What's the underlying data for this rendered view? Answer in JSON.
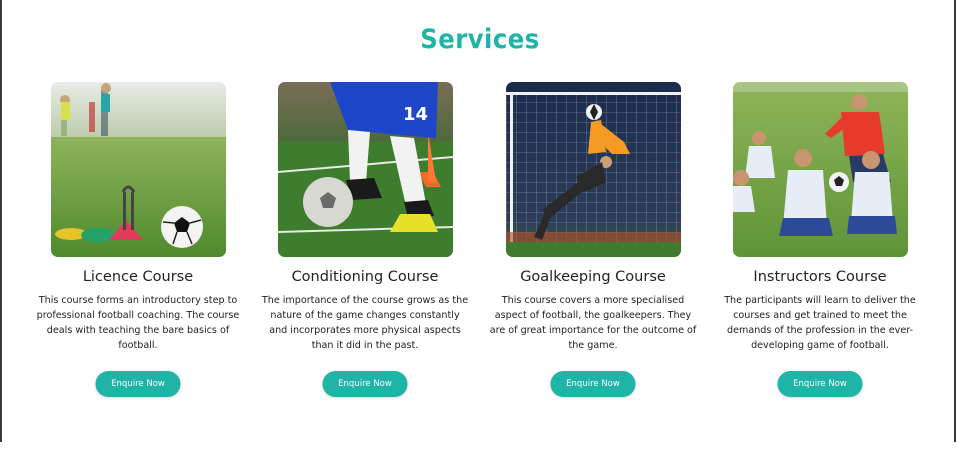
{
  "section": {
    "title": "Services"
  },
  "colors": {
    "accent": "#1fb5a6",
    "text": "#222222"
  },
  "cards": [
    {
      "image_icon": "football-cones-photo",
      "title": "Licence Course",
      "description": "This course forms an introductory step to professional football coaching. The course deals with teaching the bare basics of football.",
      "button": "Enquire Now"
    },
    {
      "image_icon": "player-dribbling-photo",
      "title": "Conditioning Course",
      "description": "The importance of the course grows as the nature of the game changes constantly and incorporates more physical aspects than it did in the past.",
      "button": "Enquire Now"
    },
    {
      "image_icon": "goalkeeper-dive-photo",
      "title": "Goalkeeping Course",
      "description": "This course covers a more specialised aspect of football, the goalkeepers. They are of great importance for the outcome of the game.",
      "button": "Enquire Now"
    },
    {
      "image_icon": "coach-instructing-kids-photo",
      "title": "Instructors Course",
      "description": "The participants will learn to deliver the courses and get trained to meet the demands of the profession in the ever-developing game of football.",
      "button": "Enquire Now"
    }
  ]
}
